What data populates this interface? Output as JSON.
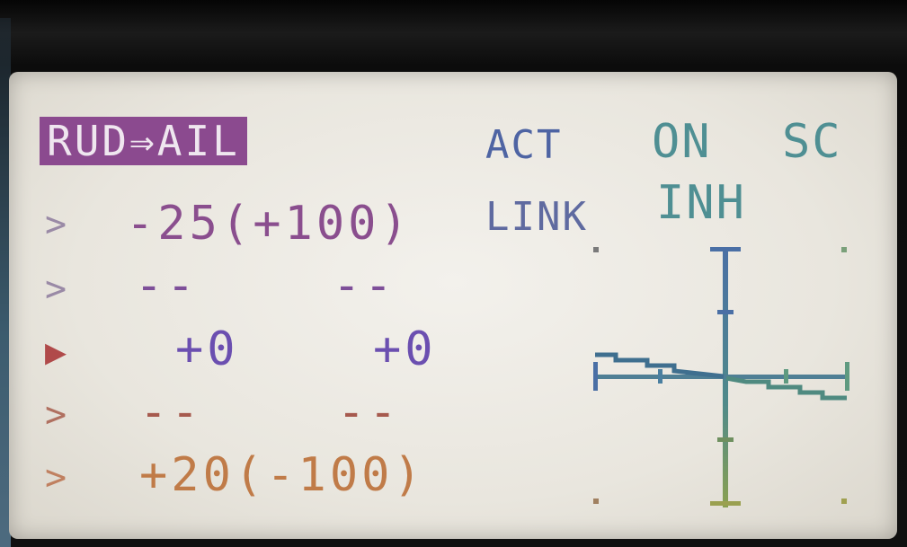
{
  "screen": {
    "title": "RUD⇒AIL",
    "act_label": "ACT",
    "act_value": "ON",
    "switch_label": "SC",
    "link_label": "LINK",
    "link_value": "INH"
  },
  "rows": [
    {
      "cursor": ">",
      "left": "-25(+100)",
      "right": ""
    },
    {
      "cursor": ">",
      "left": "--",
      "right": "--"
    },
    {
      "cursor": "▶",
      "left": "+0",
      "right": "+0"
    },
    {
      "cursor": ">",
      "left": "--",
      "right": "--"
    },
    {
      "cursor": ">",
      "left": "+20(-100)",
      "right": ""
    }
  ],
  "colors": {
    "title_bg": "#8b4a8f",
    "row_colors": [
      "#8a4e8e",
      "#7e4f99",
      "#6b4fb0",
      "#a65a4e",
      "#c07b48"
    ],
    "cursor_colors": [
      "#9a8aa6",
      "#9a8aa6",
      "#b04a4a",
      "#b07060",
      "#c08060"
    ],
    "graph_axis": "#4a6fa5",
    "graph_axis_bottom": "#8aa050",
    "graph_curve": "#3f7a7a"
  },
  "curve": {
    "left_value": -25,
    "right_value": 20
  }
}
